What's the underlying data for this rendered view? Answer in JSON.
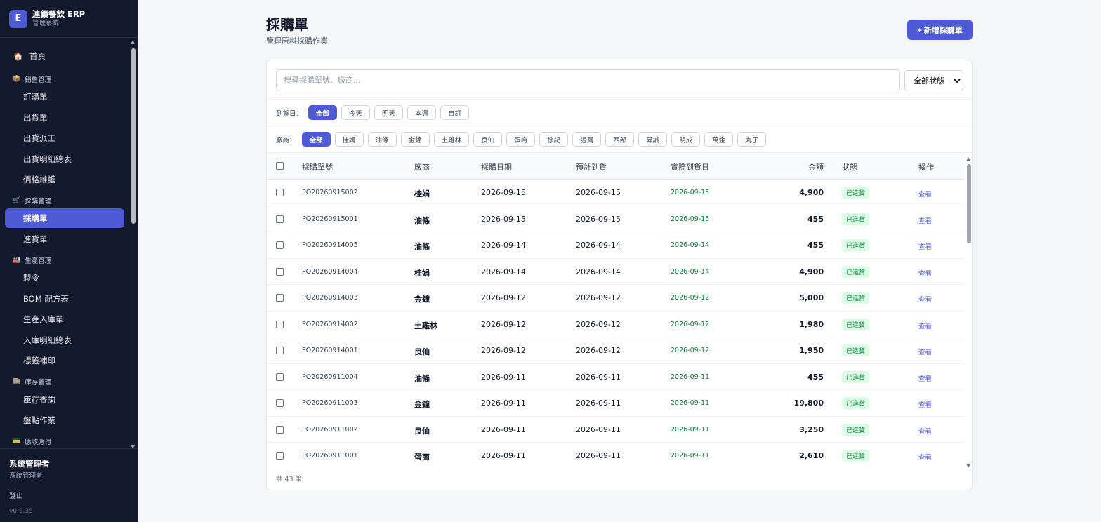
{
  "brand": {
    "logo": "E",
    "title": "連鎖餐飲 ERP",
    "subtitle": "管理系統"
  },
  "nav": {
    "home": {
      "label": "首頁",
      "icon": "house-icon"
    },
    "sections": {
      "sales": {
        "label": "銷售管理",
        "items": [
          "訂購單",
          "出貨單",
          "出貨派工",
          "出貨明細總表",
          "價格維護"
        ]
      },
      "purchase": {
        "label": "採購管理",
        "items": [
          "採購單",
          "進貨單"
        ]
      },
      "production": {
        "label": "生產管理",
        "items": [
          "製令",
          "BOM 配方表",
          "生產入庫單",
          "入庫明細總表",
          "標籤補印"
        ]
      },
      "inventory": {
        "label": "庫存管理",
        "items": [
          "庫存查詢",
          "盤點作業"
        ]
      },
      "ar": {
        "label": "應收應付"
      }
    }
  },
  "user": {
    "name": "系統管理者",
    "role": "系統管理者",
    "logout": "登出",
    "version": "v0.9.35"
  },
  "page": {
    "title": "採購單",
    "subtitle": "管理原料採購作業",
    "add_button": "+ 新增採購單"
  },
  "search": {
    "placeholder": "搜尋採購單號、廠商...",
    "status_selected": "全部狀態"
  },
  "filters": {
    "arrival_label": "到貨日：",
    "arrival_options": [
      "全部",
      "今天",
      "明天",
      "本週",
      "自訂"
    ],
    "vendor_label": "廠商：",
    "vendor_options": [
      "全部",
      "桂娟",
      "油條",
      "金鐘",
      "土雞林",
      "良仙",
      "蛋商",
      "徐記",
      "證買",
      "西部",
      "昇誠",
      "明成",
      "萬金",
      "丸子"
    ]
  },
  "table": {
    "headers": {
      "no": "採購單號",
      "vendor": "廠商",
      "date": "採購日期",
      "eta": "預計到貨",
      "actual": "實際到貨日",
      "amount": "金額",
      "status": "狀態",
      "action": "操作"
    },
    "rows": [
      {
        "no": "PO20260915002",
        "vendor": "桂娟",
        "date": "2026-09-15",
        "eta": "2026-09-15",
        "actual": "2026-09-15",
        "amount": "4,900",
        "status": "已進貨",
        "action": "查看"
      },
      {
        "no": "PO20260915001",
        "vendor": "油條",
        "date": "2026-09-15",
        "eta": "2026-09-15",
        "actual": "2026-09-15",
        "amount": "455",
        "status": "已進貨",
        "action": "查看"
      },
      {
        "no": "PO20260914005",
        "vendor": "油條",
        "date": "2026-09-14",
        "eta": "2026-09-14",
        "actual": "2026-09-14",
        "amount": "455",
        "status": "已進貨",
        "action": "查看"
      },
      {
        "no": "PO20260914004",
        "vendor": "桂娟",
        "date": "2026-09-14",
        "eta": "2026-09-14",
        "actual": "2026-09-14",
        "amount": "4,900",
        "status": "已進貨",
        "action": "查看"
      },
      {
        "no": "PO20260914003",
        "vendor": "金鐘",
        "date": "2026-09-12",
        "eta": "2026-09-12",
        "actual": "2026-09-12",
        "amount": "5,000",
        "status": "已進貨",
        "action": "查看"
      },
      {
        "no": "PO20260914002",
        "vendor": "土雞林",
        "date": "2026-09-12",
        "eta": "2026-09-12",
        "actual": "2026-09-12",
        "amount": "1,980",
        "status": "已進貨",
        "action": "查看"
      },
      {
        "no": "PO20260914001",
        "vendor": "良仙",
        "date": "2026-09-12",
        "eta": "2026-09-12",
        "actual": "2026-09-12",
        "amount": "1,950",
        "status": "已進貨",
        "action": "查看"
      },
      {
        "no": "PO20260911004",
        "vendor": "油條",
        "date": "2026-09-11",
        "eta": "2026-09-11",
        "actual": "2026-09-11",
        "amount": "455",
        "status": "已進貨",
        "action": "查看"
      },
      {
        "no": "PO20260911003",
        "vendor": "金鐘",
        "date": "2026-09-11",
        "eta": "2026-09-11",
        "actual": "2026-09-11",
        "amount": "19,800",
        "status": "已進貨",
        "action": "查看"
      },
      {
        "no": "PO20260911002",
        "vendor": "良仙",
        "date": "2026-09-11",
        "eta": "2026-09-11",
        "actual": "2026-09-11",
        "amount": "3,250",
        "status": "已進貨",
        "action": "查看"
      },
      {
        "no": "PO20260911001",
        "vendor": "蛋商",
        "date": "2026-09-11",
        "eta": "2026-09-11",
        "actual": "2026-09-11",
        "amount": "2,610",
        "status": "已進貨",
        "action": "查看"
      }
    ],
    "total": "共 43 筆"
  },
  "colors": {
    "accent": "#4f5bd5",
    "sidebar_bg": "#141a2e",
    "success_text": "#15803d",
    "success_bg": "#dcfce7"
  }
}
